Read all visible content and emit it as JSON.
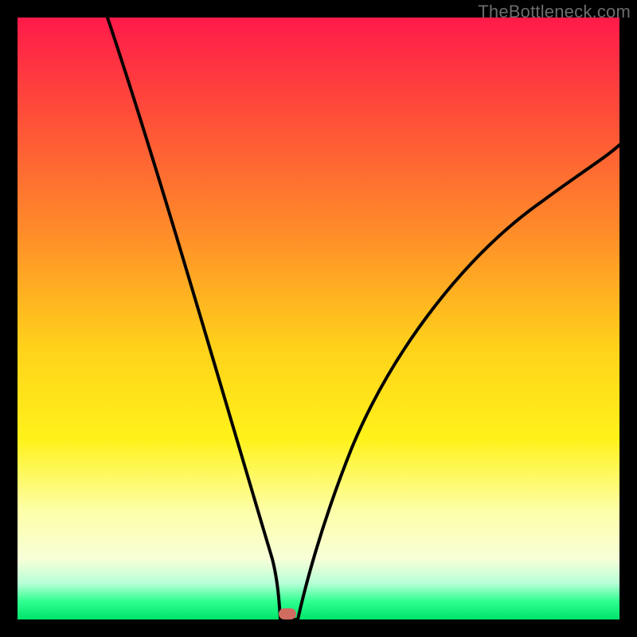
{
  "watermark": "TheBottleneck.com",
  "chart_data": {
    "type": "line",
    "title": "",
    "xlabel": "",
    "ylabel": "",
    "xlim": [
      0,
      100
    ],
    "ylim": [
      0,
      100
    ],
    "background_gradient": {
      "top": "#ff1a4a",
      "bottom": "#00e46a",
      "note": "vertical red→orange→yellow→green gradient; y≈0 green (good), y≈100 red (bad)"
    },
    "series": [
      {
        "name": "left-branch",
        "x": [
          15,
          20,
          25,
          30,
          35,
          40,
          41,
          42,
          43,
          43.5
        ],
        "y": [
          100,
          82,
          64,
          46,
          28,
          10,
          7,
          4,
          1,
          0
        ]
      },
      {
        "name": "right-branch",
        "x": [
          46,
          47,
          49,
          52,
          56,
          62,
          70,
          80,
          90,
          100
        ],
        "y": [
          0,
          3,
          9,
          18,
          28,
          40,
          52,
          63,
          72,
          80
        ]
      }
    ],
    "marker": {
      "x": 44.5,
      "y": 0,
      "color": "#cf6d60"
    }
  },
  "colors": {
    "frame_border": "#000000",
    "curve": "#000000",
    "marker": "#cf6d60",
    "watermark": "#6c6c6c"
  }
}
